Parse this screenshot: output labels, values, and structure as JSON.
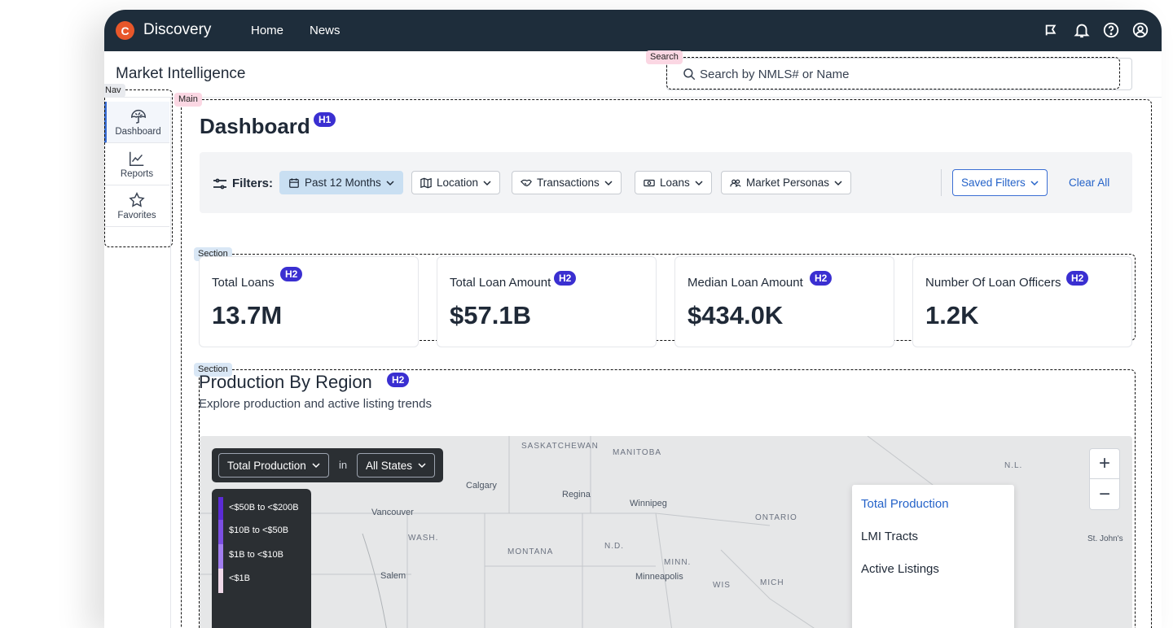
{
  "topbar": {
    "logo_letter": "C",
    "brand": "Discovery",
    "nav": [
      "Home",
      "News"
    ],
    "icons": [
      "announcement-icon",
      "bell-icon",
      "help-icon",
      "account-icon"
    ]
  },
  "header": {
    "title": "Market Intelligence",
    "search_placeholder": "Search by NMLS# or Name"
  },
  "annotations": {
    "search": "Search",
    "nav": "Nav",
    "main": "Main",
    "section": "Section",
    "h1": "H1",
    "h2": "H2"
  },
  "sidenav": {
    "items": [
      {
        "label": "Dashboard",
        "icon": "dashboard-icon",
        "active": true
      },
      {
        "label": "Reports",
        "icon": "chart-line-icon",
        "active": false
      },
      {
        "label": "Favorites",
        "icon": "star-icon",
        "active": false
      }
    ]
  },
  "main": {
    "title": "Dashboard",
    "filters": {
      "label": "Filters:",
      "chips": [
        "Past 12 Months",
        "Location",
        "Transactions",
        "Loans",
        "Market Personas"
      ],
      "saved": "Saved Filters",
      "clear": "Clear All"
    },
    "stats": [
      {
        "label": "Total Loans",
        "value": "13.7M"
      },
      {
        "label": "Total Loan Amount",
        "value": "$57.1B"
      },
      {
        "label": "Median Loan Amount",
        "value": "$434.0K"
      },
      {
        "label": "Number Of Loan Officers",
        "value": "1.2K"
      }
    ],
    "region": {
      "title": "Production By Region",
      "subtitle": "Explore production and active listing trends",
      "metric": "Total Production",
      "in": "in",
      "scope": "All States",
      "legend": [
        "<$50B to <$200B",
        "$10B to <$50B",
        "$1B to <$10B",
        "<$1B"
      ],
      "layer_options": [
        "Total Production",
        "LMI Tracts",
        "Active Listings"
      ],
      "zoom_in": "+",
      "zoom_out": "−",
      "map_labels": [
        "SASKATCHEWAN",
        "MANITOBA",
        "ONTARIO",
        "N.L.",
        "WASH.",
        "N.D.",
        "MONTANA",
        "MINN.",
        "WIS",
        "MICH"
      ],
      "map_cities": [
        "Calgary",
        "Regina",
        "Winnipeg",
        "Vancouver",
        "Salem",
        "Minneapolis",
        "St. John's"
      ]
    }
  },
  "colors": {
    "topbar": "#1e2d3b",
    "accent": "#2563c9",
    "logo": "#e8572a",
    "badge": "#3a2fd1"
  }
}
